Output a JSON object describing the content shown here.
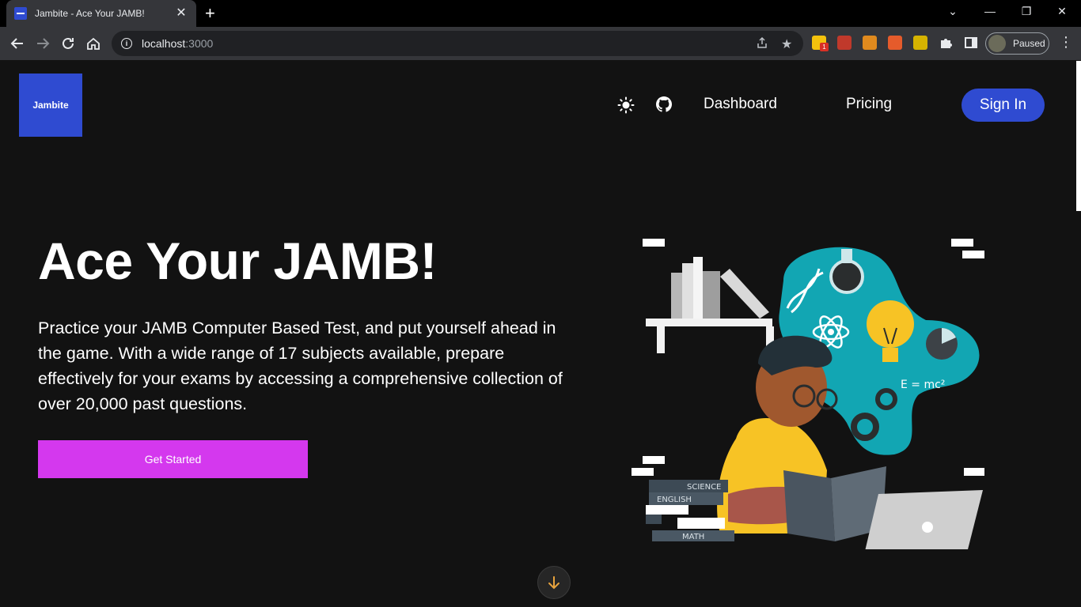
{
  "browser": {
    "tab_title": "Jambite - Ace Your JAMB!",
    "tab_close": "✕",
    "new_tab": "+",
    "url_host": "localhost",
    "url_port": ":3000",
    "profile_status": "Paused",
    "extension_badge": "1"
  },
  "site": {
    "logo_text": "Jambite",
    "nav": {
      "dashboard": "Dashboard",
      "pricing": "Pricing",
      "signin": "Sign In"
    }
  },
  "hero": {
    "title": "Ace Your JAMB!",
    "description": "Practice your JAMB Computer Based Test, and put yourself ahead in the game. With a wide range of 17 subjects available, prepare effectively for your exams by accessing a comprehensive collection of over 20,000 past questions.",
    "cta": "Get Started"
  },
  "illustration": {
    "book_labels": [
      "SCIENCE",
      "ENGLISH",
      "MATH"
    ],
    "formula": "E = mc²"
  },
  "colors": {
    "brand_blue": "#2f4bd1",
    "cta_magenta": "#d438ee",
    "page_bg": "#121212",
    "scroll_arrow": "#e8a33d"
  }
}
